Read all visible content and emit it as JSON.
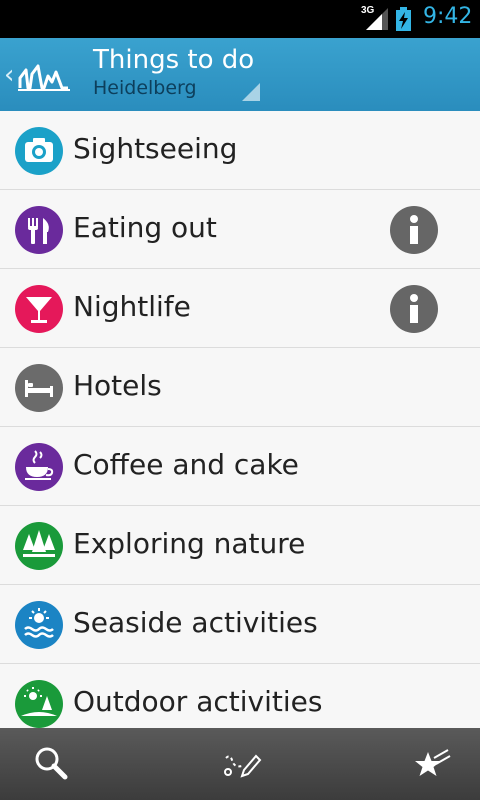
{
  "status_bar": {
    "network": "3G",
    "time": "9:42"
  },
  "action_bar": {
    "title": "Things to do",
    "subtitle": "Heidelberg"
  },
  "categories": [
    {
      "label": "Sightseeing",
      "color": "#1ba1c8",
      "icon": "camera-icon",
      "info": false
    },
    {
      "label": "Eating out",
      "color": "#6a2a9c",
      "icon": "fork-knife-icon",
      "info": true
    },
    {
      "label": "Nightlife",
      "color": "#e5185a",
      "icon": "cocktail-icon",
      "info": true
    },
    {
      "label": "Hotels",
      "color": "#6b6b6b",
      "icon": "bed-icon",
      "info": false
    },
    {
      "label": "Coffee and cake",
      "color": "#6a2a9c",
      "icon": "coffee-cup-icon",
      "info": false
    },
    {
      "label": "Exploring nature",
      "color": "#1a9a3a",
      "icon": "trees-icon",
      "info": false
    },
    {
      "label": "Seaside activities",
      "color": "#1b84c4",
      "icon": "sun-waves-icon",
      "info": false
    },
    {
      "label": "Outdoor activities",
      "color": "#1a9a3a",
      "icon": "sun-tree-icon",
      "info": false
    }
  ],
  "bottom_bar": {
    "icons": [
      "search-icon",
      "route-pencil-icon",
      "favorites-star-icon"
    ]
  }
}
